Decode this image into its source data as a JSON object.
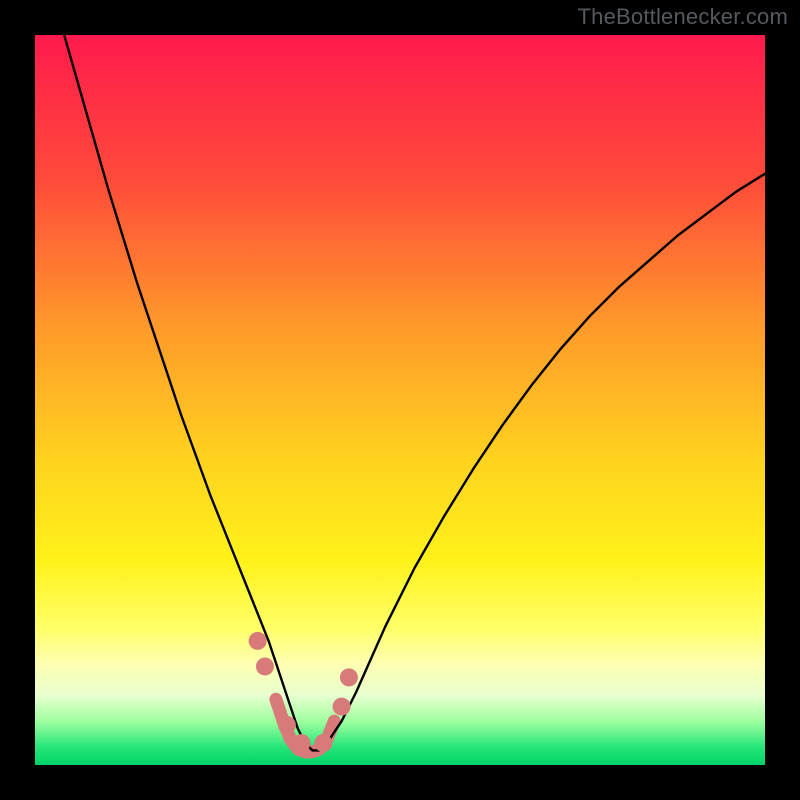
{
  "watermark": {
    "text": "TheBottlenecker.com"
  },
  "chart_data": {
    "type": "line",
    "title": "",
    "xlabel": "",
    "ylabel": "",
    "xlim": [
      0,
      100
    ],
    "ylim": [
      0,
      100
    ],
    "grid": false,
    "background": {
      "gradient_stops": [
        {
          "offset": 0.0,
          "color": "#ff1a4d"
        },
        {
          "offset": 0.2,
          "color": "#ff4b3a"
        },
        {
          "offset": 0.4,
          "color": "#ff9a2a"
        },
        {
          "offset": 0.58,
          "color": "#ffd21f"
        },
        {
          "offset": 0.72,
          "color": "#fff21a"
        },
        {
          "offset": 0.81,
          "color": "#ffff66"
        },
        {
          "offset": 0.86,
          "color": "#ffffb0"
        },
        {
          "offset": 0.905,
          "color": "#e8ffd0"
        },
        {
          "offset": 0.94,
          "color": "#9fff9f"
        },
        {
          "offset": 0.975,
          "color": "#28e67a"
        },
        {
          "offset": 1.0,
          "color": "#00d368"
        }
      ]
    },
    "series": [
      {
        "name": "bottleneck-curve",
        "color": "#000000",
        "stroke_width": 2.4,
        "x": [
          4,
          6,
          8,
          10,
          12,
          14,
          16,
          18,
          20,
          22,
          24,
          26,
          28,
          30,
          32,
          33,
          34,
          35,
          36,
          37,
          38,
          39,
          40,
          42,
          44,
          46,
          48,
          52,
          56,
          60,
          64,
          68,
          72,
          76,
          80,
          84,
          88,
          92,
          96,
          100
        ],
        "y": [
          100,
          93,
          86,
          79,
          72.5,
          66,
          60,
          54,
          48,
          42.5,
          37,
          32,
          27,
          22,
          17,
          14,
          11,
          8,
          5,
          3,
          2,
          2,
          3,
          6,
          10,
          14.5,
          19,
          27,
          34,
          40.5,
          46.5,
          52,
          57,
          61.5,
          65.5,
          69,
          72.5,
          75.5,
          78.5,
          81
        ]
      },
      {
        "name": "curve-markers",
        "type": "scatter",
        "color": "#d87a7a",
        "radius": 9,
        "x": [
          30.5,
          31.5,
          34.5,
          36.5,
          39.5,
          42.0,
          43.0
        ],
        "y": [
          17.0,
          13.5,
          5.5,
          3.0,
          3.0,
          8.0,
          12.0
        ]
      },
      {
        "name": "curve-bottom-stroke",
        "type": "line",
        "color": "#d87a7a",
        "stroke_width": 13,
        "x": [
          33,
          34,
          35,
          36,
          37,
          38,
          39,
          40,
          41
        ],
        "y": [
          9,
          6,
          3.5,
          2.2,
          1.8,
          1.8,
          2.2,
          3.5,
          6
        ]
      }
    ]
  }
}
